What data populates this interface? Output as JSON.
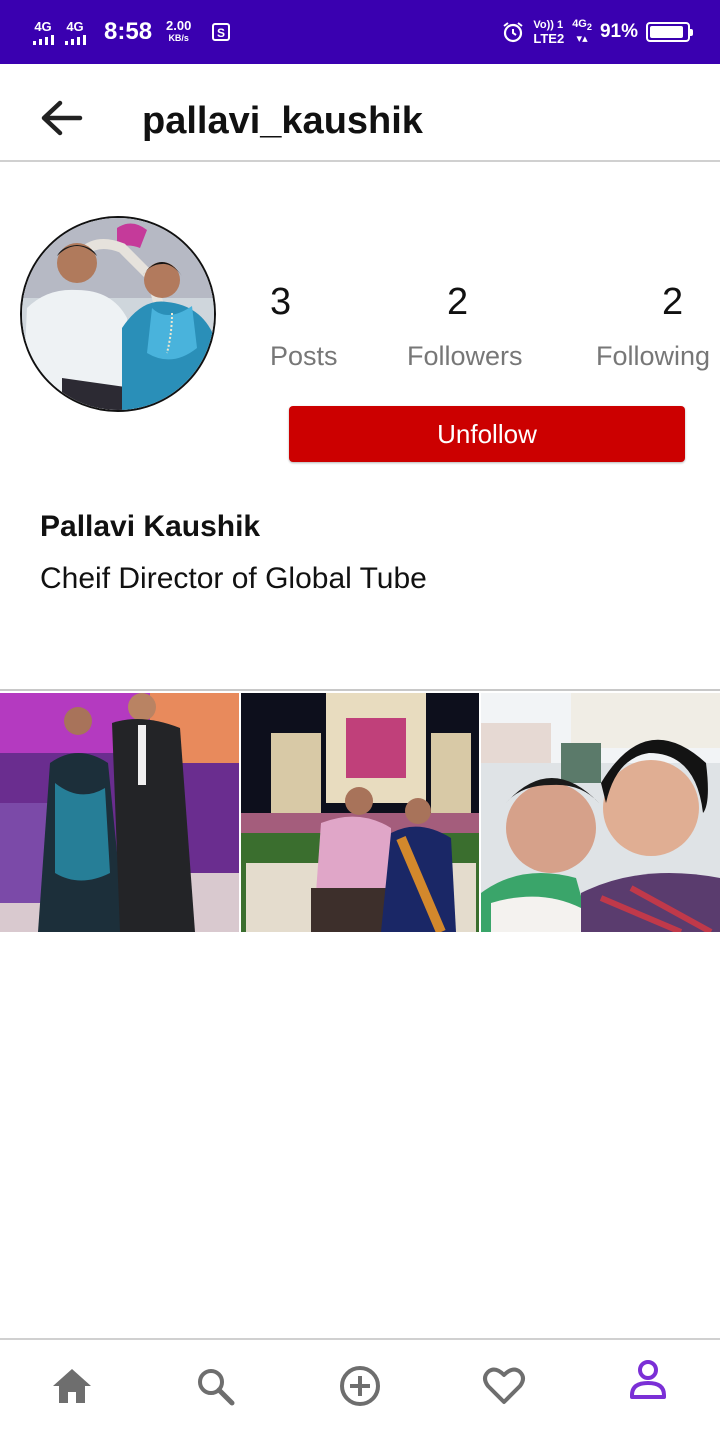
{
  "status_bar": {
    "network1": "4G",
    "network2": "4G",
    "time": "8:58",
    "speed_value": "2.00",
    "speed_unit": "KB/s",
    "volte_top": "Vo)) 1",
    "volte_bottom": "LTE2",
    "net_right_top": "4G",
    "net_right_sub": "2",
    "battery_percent": "91%",
    "battery_level": 0.91
  },
  "header": {
    "username": "pallavi_kaushik"
  },
  "profile": {
    "posts_count": "3",
    "posts_label": "Posts",
    "followers_count": "2",
    "followers_label": "Followers",
    "following_count": "2",
    "following_label": "Following",
    "unfollow_label": "Unfollow",
    "full_name": "Pallavi Kaushik",
    "bio": "Cheif Director of Global Tube"
  },
  "nav": {
    "items": [
      "home-icon",
      "search-icon",
      "add-circle-icon",
      "heart-icon",
      "profile-icon"
    ],
    "active": "profile-icon",
    "active_color": "#7b2fd6",
    "inactive_color": "#6e6e6e"
  },
  "colors": {
    "status_bar": "#3a00b0",
    "unfollow_button": "#cc0000"
  }
}
